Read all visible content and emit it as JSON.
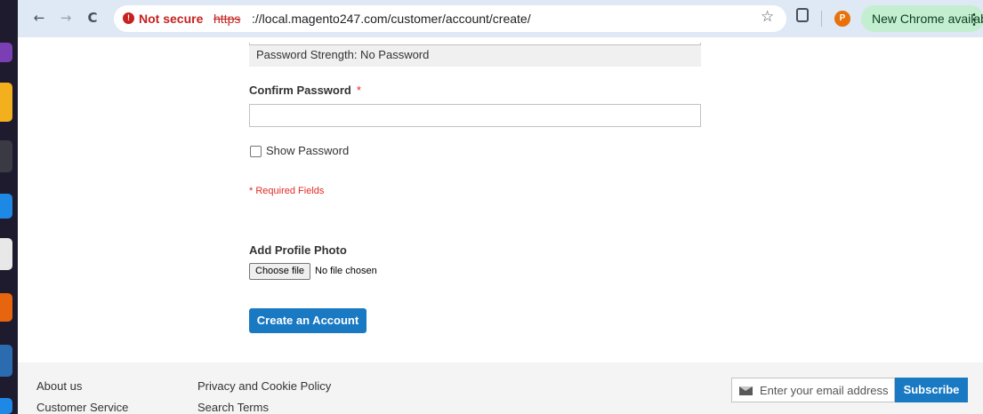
{
  "browser": {
    "security_label": "Not secure",
    "url_scheme": "https",
    "url_rest": "://local.magento247.com/customer/account/create/",
    "profile_initial": "P",
    "update_label": "New Chrome available",
    "kebab_glyph": "⋮",
    "back_glyph": "←",
    "forward_glyph": "→",
    "reload_glyph": "C",
    "star_glyph": "☆"
  },
  "form": {
    "password_strength": "Password Strength: No Password",
    "confirm_label": "Confirm Password",
    "required_marker": "*",
    "show_password": "Show Password",
    "required_fields": "* Required Fields",
    "photo_label": "Add Profile Photo",
    "choose_file": "Choose file",
    "file_status": "No file chosen",
    "submit": "Create an Account"
  },
  "footer": {
    "col1": [
      "About us",
      "Customer Service"
    ],
    "col2": [
      "Privacy and Cookie Policy",
      "Search Terms"
    ],
    "newsletter_placeholder": "Enter your email address",
    "subscribe": "Subscribe"
  },
  "colors": {
    "accent": "#1979c3",
    "danger": "#e02b27",
    "update_pill": "#c4eed0"
  }
}
